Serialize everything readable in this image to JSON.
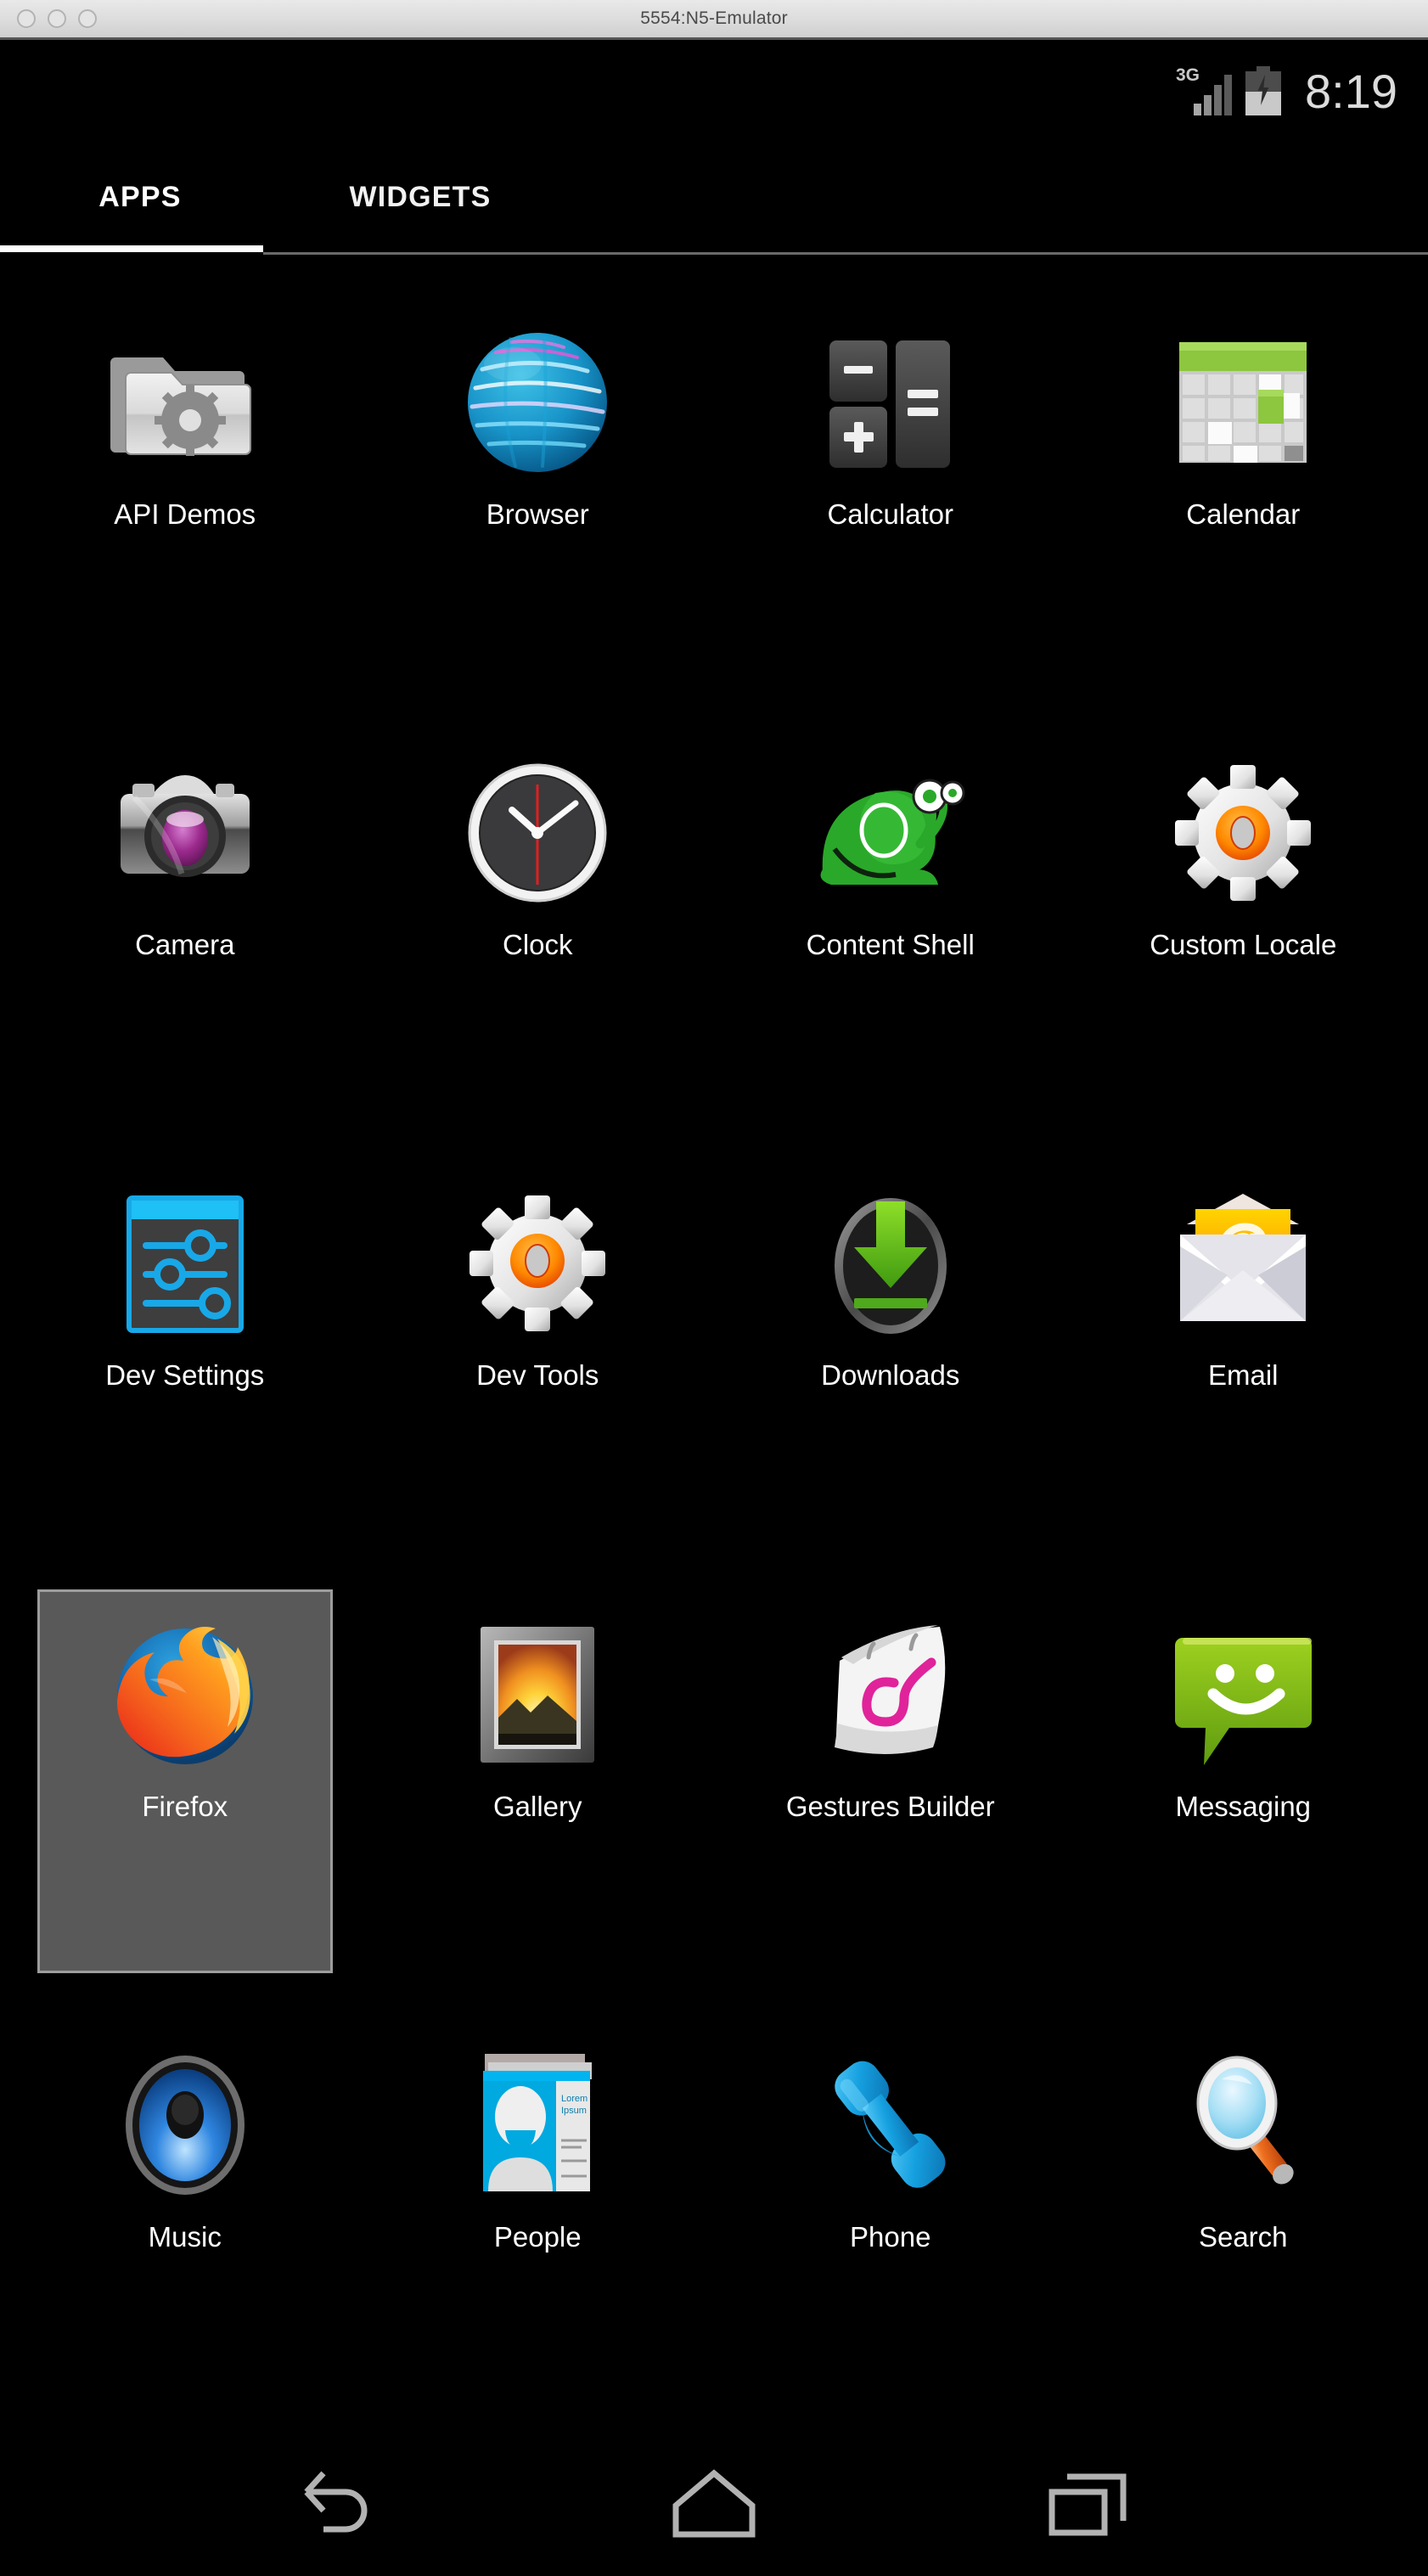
{
  "window": {
    "title": "5554:N5-Emulator",
    "traffic_lights": [
      "close",
      "minimize",
      "zoom"
    ]
  },
  "status_bar": {
    "network_label": "3G",
    "signal_icon": "signal-bars-icon",
    "battery_icon": "battery-charging-icon",
    "time": "8:19"
  },
  "tabs": {
    "items": [
      {
        "label": "APPS",
        "selected": true
      },
      {
        "label": "WIDGETS",
        "selected": false
      }
    ]
  },
  "app_drawer": {
    "apps": [
      {
        "label": "API Demos",
        "icon": "folder-gear-icon",
        "selected": false
      },
      {
        "label": "Browser",
        "icon": "globe-icon",
        "selected": false
      },
      {
        "label": "Calculator",
        "icon": "calculator-keys-icon",
        "selected": false
      },
      {
        "label": "Calendar",
        "icon": "calendar-grid-icon",
        "selected": false
      },
      {
        "label": "Camera",
        "icon": "camera-icon",
        "selected": false
      },
      {
        "label": "Clock",
        "icon": "analog-clock-icon",
        "selected": false
      },
      {
        "label": "Content Shell",
        "icon": "green-snail-icon",
        "selected": false
      },
      {
        "label": "Custom Locale",
        "icon": "gear-orange-icon",
        "selected": false
      },
      {
        "label": "Dev Settings",
        "icon": "sliders-panel-icon",
        "selected": false
      },
      {
        "label": "Dev Tools",
        "icon": "gear-orange-icon",
        "selected": false
      },
      {
        "label": "Downloads",
        "icon": "download-arrow-icon",
        "selected": false
      },
      {
        "label": "Email",
        "icon": "envelope-at-icon",
        "selected": false
      },
      {
        "label": "Firefox",
        "icon": "firefox-icon",
        "selected": true
      },
      {
        "label": "Gallery",
        "icon": "photo-frame-icon",
        "selected": false
      },
      {
        "label": "Gestures Builder",
        "icon": "notepad-gesture-icon",
        "selected": false
      },
      {
        "label": "Messaging",
        "icon": "chat-bubble-smiley-icon",
        "selected": false
      },
      {
        "label": "Music",
        "icon": "speaker-icon",
        "selected": false
      },
      {
        "label": "People",
        "icon": "contact-card-icon",
        "selected": false
      },
      {
        "label": "Phone",
        "icon": "phone-handset-icon",
        "selected": false
      },
      {
        "label": "Search",
        "icon": "magnifier-icon",
        "selected": false
      }
    ],
    "people_card_text": {
      "name_line1": "Lorem",
      "name_line2": "Ipsum"
    }
  },
  "nav_bar": {
    "buttons": [
      {
        "name": "back",
        "icon": "back-arrow-icon"
      },
      {
        "name": "home",
        "icon": "home-icon"
      },
      {
        "name": "recents",
        "icon": "recents-icon"
      }
    ]
  },
  "colors": {
    "screen_background": "#000000",
    "selection_fill": "#595959",
    "selection_border": "#9d9d9d",
    "tab_indicator": "#ffffff",
    "status_text": "#dcdcdc",
    "label_text": "#ffffff",
    "calendar_green": "#8dc63f",
    "messaging_green": "#7cb518",
    "firefox_orange": "#f26722",
    "people_cyan": "#00a9e0",
    "phone_blue": "#29abe2"
  }
}
